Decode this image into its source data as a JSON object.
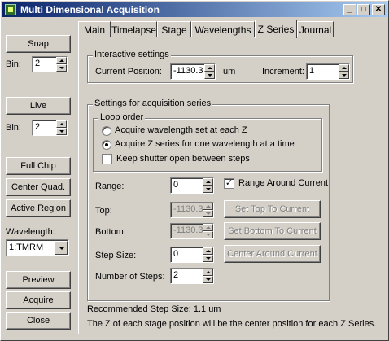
{
  "window": {
    "title": "Multi Dimensional Acquisition",
    "minimize": "_",
    "maximize": "□",
    "close": "✕"
  },
  "left": {
    "snap_label": "Snap",
    "bin_label": "Bin:",
    "snap_bin_value": "2",
    "live_label": "Live",
    "live_bin_label": "Bin:",
    "live_bin_value": "2",
    "full_chip_label": "Full Chip",
    "center_quad_label": "Center Quad.",
    "active_region_label": "Active Region",
    "wavelength_label": "Wavelength:",
    "wavelength_value": "1:TMRM",
    "preview_label": "Preview",
    "acquire_label": "Acquire",
    "close_label": "Close"
  },
  "tabs": [
    "Main",
    "Timelapse",
    "Stage",
    "Wavelengths",
    "Z Series",
    "Journal"
  ],
  "active_tab": "Z Series",
  "interactive": {
    "group_title": "Interactive settings",
    "current_position_label": "Current Position:",
    "current_position_value": "-1130.3",
    "unit": "um",
    "increment_label": "Increment:",
    "increment_value": "1"
  },
  "series": {
    "group_title": "Settings for acquisition series",
    "loop_title": "Loop order",
    "option1": "Acquire wavelength set at each Z",
    "option2": "Acquire Z series for one wavelength at a time",
    "selected_option": 2,
    "shutter_label": "Keep shutter open between steps",
    "shutter_checked": false,
    "range_label": "Range:",
    "range_value": "0",
    "range_around_label": "Range Around Current",
    "range_around_checked": true,
    "top_label": "Top:",
    "top_value": "-1130.3",
    "bottom_label": "Bottom:",
    "bottom_value": "-1130.3",
    "step_label": "Step Size:",
    "step_value": "0",
    "num_steps_label": "Number of Steps:",
    "num_steps_value": "2",
    "set_top_label": "Set Top To Current",
    "set_bottom_label": "Set Bottom To Current",
    "center_around_label": "Center Around Current"
  },
  "footer": {
    "recommended": "Recommended Step Size: 1.1 um",
    "note": "The Z of each stage position will be the center position for each Z Series."
  },
  "colors": {
    "title_start": "#0a246a",
    "title_end": "#a6caf0",
    "face": "#d4d0c8"
  }
}
